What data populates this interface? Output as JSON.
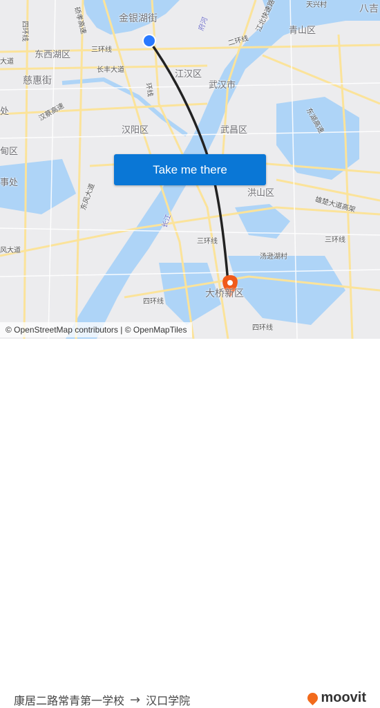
{
  "map": {
    "labels": {
      "jinyinhu": "金银湖街",
      "dongxihu": "东西湖区",
      "cihui": "慈惠街",
      "jianghan": "江汉区",
      "wuhan": "武汉市",
      "hanyang": "汉阳区",
      "wuchang": "武昌区",
      "hongshan": "洪山区",
      "qingshan": "青山区",
      "tianxing": "天兴村",
      "baji": "八吉",
      "tangxunhu": "汤逊湖村",
      "daqiao": "大桥新区",
      "chu": "处",
      "xiangqu": "甸区",
      "banshichu": "事处",
      "sanhuan1": "三环线",
      "sanhuan2": "三环线",
      "sanhuan3": "三环线",
      "sanhuan4": "三环线",
      "erhuan": "二环线",
      "sihuan": "四环线",
      "sihuan2": "四环线",
      "changfeng": "长丰大道",
      "dadao": "大道",
      "hancai": "汉蔡高速",
      "donghu": "东湖高速",
      "xiongchu": "雄楚大道高架",
      "siyuan": "四环线",
      "yuxiao": "硚孝高速",
      "fengdadao": "风大道",
      "dongfeng": "东风大道",
      "changjiang": "长江",
      "fuhe": "府河",
      "jiangbei": "江北快速路",
      "huanxian": "环线"
    }
  },
  "cta": {
    "label": "Take me there"
  },
  "attribution": "© OpenStreetMap contributors | © OpenMapTiles",
  "footer": {
    "origin": "康居二路常青第一学校",
    "arrow": "→",
    "destination": "汉口学院",
    "brand": "moovit"
  },
  "colors": {
    "route": "#222222",
    "origin_marker": "#2979ff",
    "destination_marker": "#f05a1a",
    "cta": "#0a77d6",
    "water": "#aed4f7",
    "road": "#fbe39a"
  }
}
